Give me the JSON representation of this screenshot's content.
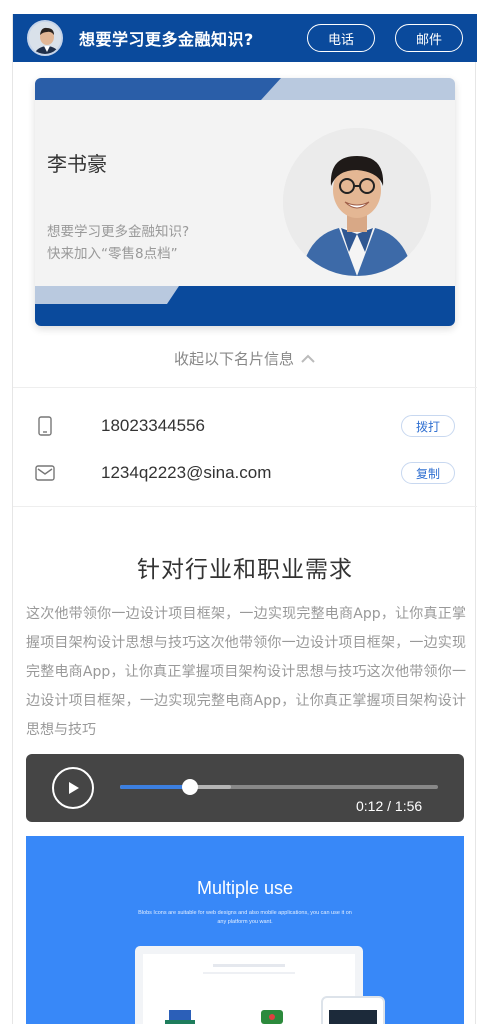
{
  "header": {
    "title": "想要学习更多金融知识?",
    "call_label": "电话",
    "mail_label": "邮件"
  },
  "card": {
    "name": "李书豪",
    "subtitle_line1": "想要学习更多金融知识?",
    "subtitle_line2": "快来加入“零售8点档”"
  },
  "collapse_label": "收起以下名片信息",
  "contacts": {
    "phone": {
      "value": "18023344556",
      "action_label": "拨打",
      "icon": "phone-icon"
    },
    "email": {
      "value": "1234q2223@sina.com",
      "action_label": "复制",
      "icon": "mail-icon"
    }
  },
  "article": {
    "heading": "针对行业和职业需求",
    "body": "这次他带领你一边设计项目框架，一边实现完整电商App，让你真正掌握项目架构设计思想与技巧这次他带领你一边设计项目框架，一边实现完整电商App，让你真正掌握项目架构设计思想与技巧这次他带领你一边设计项目框架，一边实现完整电商App，让你真正掌握项目架构设计思想与技巧"
  },
  "audio": {
    "current": "0:12",
    "separator": "/",
    "duration": "1:56",
    "time_display": "0:12 / 1:56",
    "progress": 0.22,
    "buffered": 0.35
  },
  "banner": {
    "title": "Multiple use",
    "subtitle": "Blobs Icons are suitable for web designs and also mobile applications, you can use it on any platform you want."
  },
  "colors": {
    "brand": "#0a4a9c",
    "accent": "#3c7fe0",
    "banner": "#3888f8"
  }
}
